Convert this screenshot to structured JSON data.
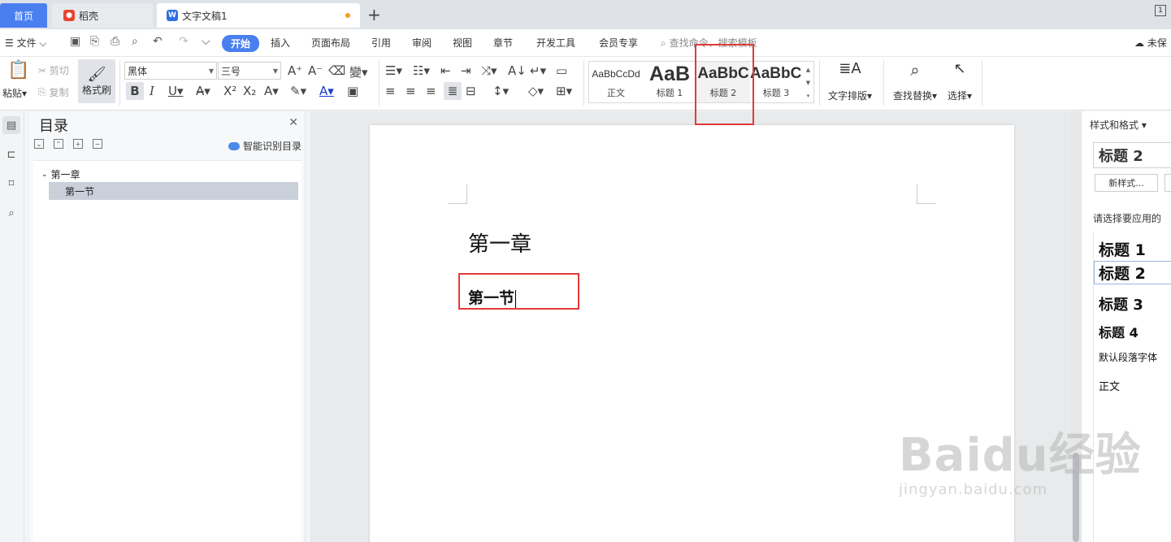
{
  "tabs": {
    "home": "首页",
    "daoke": "稻壳",
    "doc": "文字文稿1"
  },
  "window_count": "1",
  "menu": {
    "file": "文件",
    "items": [
      "开始",
      "插入",
      "页面布局",
      "引用",
      "审阅",
      "视图",
      "章节",
      "开发工具",
      "会员专享"
    ],
    "search": "查找命令、搜索模板",
    "unsaved": "未保"
  },
  "ribbon": {
    "paste": "粘贴",
    "cut": "剪切",
    "copy": "复制",
    "format_painter": "格式刷",
    "font_name": "黑体",
    "font_size": "三号",
    "text_layout": "文字排版",
    "find_replace": "查找替换",
    "select": "选择",
    "styles": [
      {
        "preview": "AaBbCcDd",
        "name": "正文"
      },
      {
        "preview": "AaB",
        "name": "标题 1"
      },
      {
        "preview": "AaBbC",
        "name": "标题 2"
      },
      {
        "preview": "AaBbC",
        "name": "标题 3"
      }
    ]
  },
  "toc": {
    "title": "目录",
    "ai_label": "智能识别目录",
    "items": [
      "第一章",
      "第一节"
    ]
  },
  "document": {
    "heading1": "第一章",
    "heading2": "第一节"
  },
  "style_pane": {
    "title": "样式和格式",
    "current": "标题 2",
    "new_style": "新样式...",
    "hint": "请选择要应用的",
    "items": [
      "标题 1",
      "标题 2",
      "标题 3",
      "标题 4",
      "默认段落字体",
      "正文"
    ]
  },
  "watermark": {
    "main": "Baidu经验",
    "sub": "jingyan.baidu.com"
  },
  "colors": {
    "accent": "#4a7ff0",
    "highlight_box": "#e23a3a"
  }
}
